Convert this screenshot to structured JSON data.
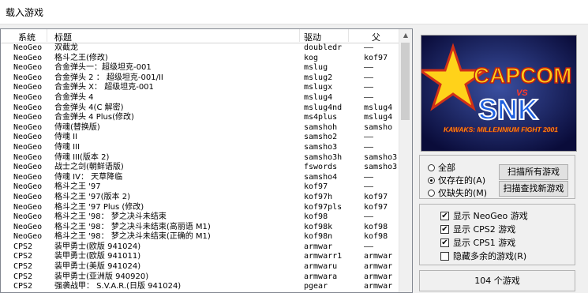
{
  "window": {
    "title": "载入游戏"
  },
  "list": {
    "columns": {
      "system": "系统",
      "title": "标题",
      "driver": "驱动",
      "parent": "父"
    },
    "rows": [
      {
        "system": "NeoGeo",
        "title": "双截龙",
        "driver": "doubledr",
        "parent": "——"
      },
      {
        "system": "NeoGeo",
        "title": "格斗之王(修改)",
        "driver": "kog",
        "parent": "kof97"
      },
      {
        "system": "NeoGeo",
        "title": "合金弹头一：超级坦克-001",
        "driver": "mslug",
        "parent": "——"
      },
      {
        "system": "NeoGeo",
        "title": "合金弹头 2 ： 超级坦克-001/II",
        "driver": "mslug2",
        "parent": "——"
      },
      {
        "system": "NeoGeo",
        "title": "合金弹头 X： 超级坦克-001",
        "driver": "mslugx",
        "parent": "——"
      },
      {
        "system": "NeoGeo",
        "title": "合金弹头 4",
        "driver": "mslug4",
        "parent": "——"
      },
      {
        "system": "NeoGeo",
        "title": "合金弹头 4(C 解密)",
        "driver": "mslug4nd",
        "parent": "mslug4"
      },
      {
        "system": "NeoGeo",
        "title": "合金弹头 4 Plus(修改)",
        "driver": "ms4plus",
        "parent": "mslug4"
      },
      {
        "system": "NeoGeo",
        "title": "侍魂(替换版)",
        "driver": "samshoh",
        "parent": "samsho"
      },
      {
        "system": "NeoGeo",
        "title": "侍魂 II",
        "driver": "samsho2",
        "parent": "——"
      },
      {
        "system": "NeoGeo",
        "title": "侍魂 III",
        "driver": "samsho3",
        "parent": "——"
      },
      {
        "system": "NeoGeo",
        "title": "侍魂 III(版本 2)",
        "driver": "samsho3h",
        "parent": "samsho3"
      },
      {
        "system": "NeoGeo",
        "title": "战士之剑(朝鲜语版)",
        "driver": "fswords",
        "parent": "samsho3"
      },
      {
        "system": "NeoGeo",
        "title": "侍魂 IV： 天草降临",
        "driver": "samsho4",
        "parent": "——"
      },
      {
        "system": "NeoGeo",
        "title": "格斗之王 '97",
        "driver": "kof97",
        "parent": "——"
      },
      {
        "system": "NeoGeo",
        "title": "格斗之王 '97(版本 2)",
        "driver": "kof97h",
        "parent": "kof97"
      },
      {
        "system": "NeoGeo",
        "title": "格斗之王 '97 Plus (修改)",
        "driver": "kof97pls",
        "parent": "kof97"
      },
      {
        "system": "NeoGeo",
        "title": "格斗之王 '98： 梦之决斗未结束",
        "driver": "kof98",
        "parent": "——"
      },
      {
        "system": "NeoGeo",
        "title": "格斗之王 '98： 梦之决斗未结束(高丽语 M1)",
        "driver": "kof98k",
        "parent": "kof98"
      },
      {
        "system": "NeoGeo",
        "title": "格斗之王 '98： 梦之决斗未结束(正确的 M1)",
        "driver": "kof98n",
        "parent": "kof98"
      },
      {
        "system": "CPS2",
        "title": "装甲勇士(欧版 941024)",
        "driver": "armwar",
        "parent": "——"
      },
      {
        "system": "CPS2",
        "title": "装甲勇士(欧版 941011)",
        "driver": "armwarr1",
        "parent": "armwar"
      },
      {
        "system": "CPS2",
        "title": "装甲勇士(美版 941024)",
        "driver": "armwaru",
        "parent": "armwar"
      },
      {
        "system": "CPS2",
        "title": "装甲勇士(亚洲版 940920)",
        "driver": "armwara",
        "parent": "armwar"
      },
      {
        "system": "CPS2",
        "title": "强袭战甲： S.V.A.R.(日版 941024)",
        "driver": "pgear",
        "parent": "armwar"
      }
    ]
  },
  "preview": {
    "logo_top": "CAPCOM",
    "logo_vs": "VS",
    "logo_bottom": "SNK",
    "logo_sub": "KAWAKS: MILLENNIUM FIGHT 2001"
  },
  "filter": {
    "options": [
      {
        "label": "全部",
        "selected": false
      },
      {
        "label": "仅存在的(A)",
        "selected": true
      },
      {
        "label": "仅缺失的(M)",
        "selected": false
      }
    ],
    "scan_all_label": "扫描所有游戏",
    "scan_new_label": "扫描查找新游戏"
  },
  "display": {
    "options": [
      {
        "label": "显示 NeoGeo 游戏",
        "checked": true
      },
      {
        "label": "显示 CPS2 游戏",
        "checked": true
      },
      {
        "label": "显示 CPS1 游戏",
        "checked": true
      },
      {
        "label": "隐藏多余的游戏(R)",
        "checked": false
      }
    ]
  },
  "status": {
    "count_label": "104 个游戏"
  }
}
